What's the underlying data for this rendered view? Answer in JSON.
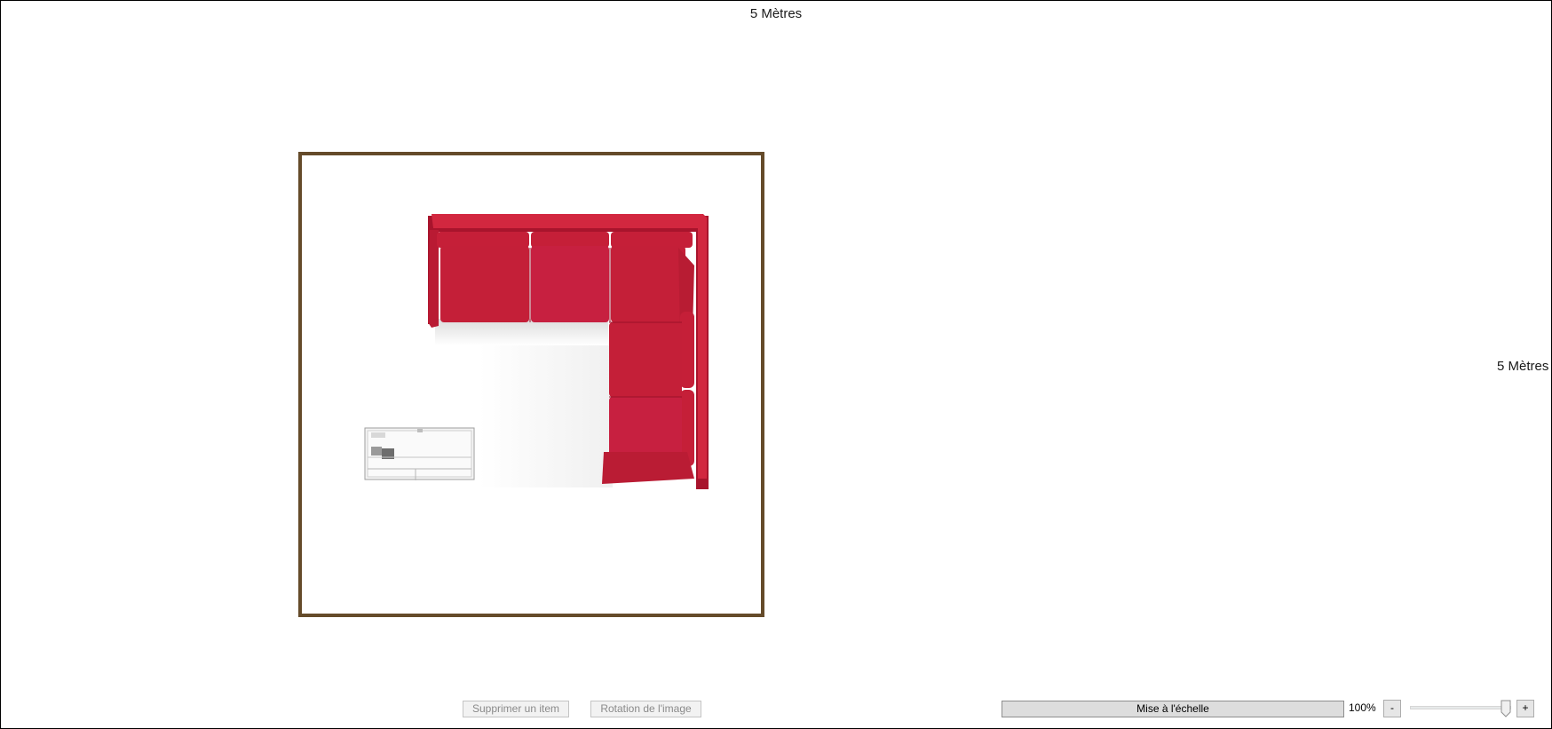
{
  "dimensions": {
    "top_label": "5 Mètres",
    "right_label": "5 Mètres"
  },
  "canvas": {
    "room_border_color": "#654b2a",
    "items": [
      {
        "icon": "corner-sofa-icon",
        "color": "#c8203a"
      },
      {
        "icon": "table-icon",
        "color": "#e8e8e8"
      }
    ]
  },
  "toolbar": {
    "delete_label": "Supprimer un item",
    "rotate_label": "Rotation de l'image",
    "scale_label": "Mise à l'échelle",
    "zoom_label": "100%",
    "zoom_value": 100,
    "zoom_out_label": "-",
    "zoom_in_label": "+"
  }
}
